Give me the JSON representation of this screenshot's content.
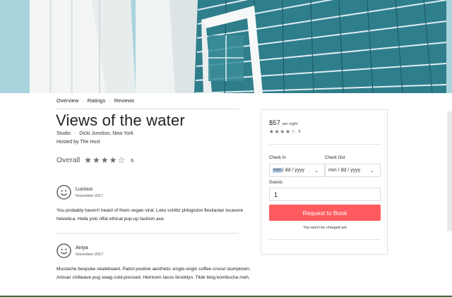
{
  "nav": {
    "items": [
      "Overview",
      "Ratings",
      "Reviews"
    ],
    "separator": "·"
  },
  "listing": {
    "title": "Views of the water",
    "type": "Studio",
    "location": "Dicki Junction, New York",
    "host": "Hosted by The Host"
  },
  "overall": {
    "label": "Overall",
    "rating": 4,
    "max": 5,
    "count": "6"
  },
  "reviews": [
    {
      "name": "Lucious",
      "date": "November 2017",
      "text": "You probably haven't heard of them vegan viral. Loko schlitz phlogiston flexitarian locavore helvetica. Hella yolo offal ethical pop-up fashion axe."
    },
    {
      "name": "Aniya",
      "date": "November 2017",
      "text": "Mustache bespoke skateboard. Pabst poutine aesthetic single-origin coffee cronut stumptown. Artisan chillwave pug swag cold-pressed. Heirloom tacos brooklyn. Tilde blog kombucha meh."
    }
  ],
  "booking": {
    "price": "$57",
    "per_night": "per night",
    "rating": 4,
    "count": "6",
    "check_in_label": "Check In",
    "check_out_label": "Check Out",
    "date_placeholder_mm": "mm",
    "date_placeholder_rest": " / dd / yyyy",
    "date_placeholder": "mm / dd / yyyy",
    "guests_label": "Guests",
    "guests_value": "1",
    "button_label": "Request to Book",
    "note": "You won't be charged yet"
  },
  "colors": {
    "accent": "#ff5a5f",
    "sky": "#a9d3dd",
    "glass": "#2f7e8c"
  }
}
